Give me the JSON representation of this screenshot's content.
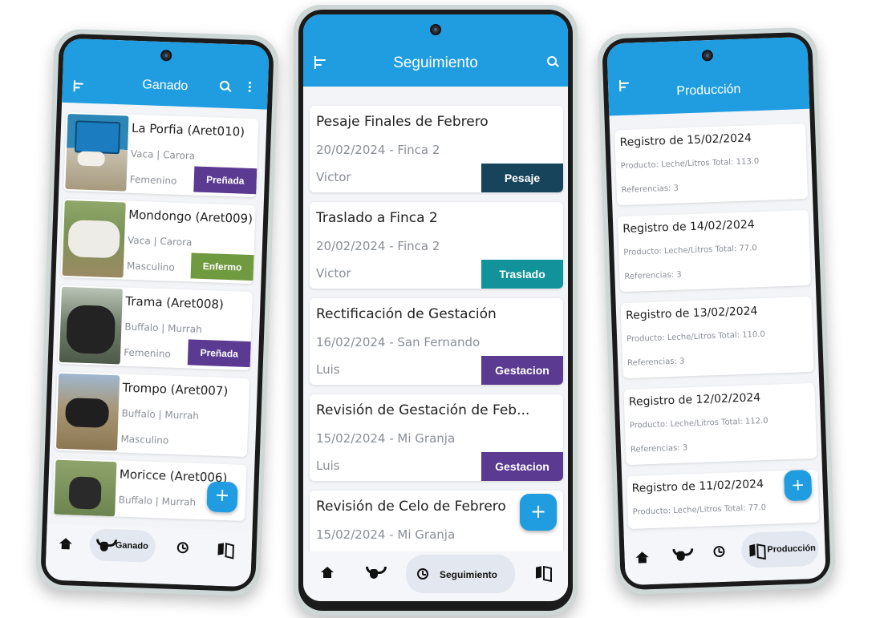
{
  "colors": {
    "primary": "#1f9de0",
    "pesaje": "#17445a",
    "traslado": "#12939b",
    "gestacion": "#5b3a91",
    "prenada": "#5b3a91",
    "enfermo": "#6f9a3f"
  },
  "ganado": {
    "title": "Ganado",
    "animals": [
      {
        "name": "La Porfia  (Aret010)",
        "breed": "Vaca | Carora",
        "sex": "Femenino",
        "status": "Preñada"
      },
      {
        "name": "Mondongo (Aret009)",
        "breed": "Vaca | Carora",
        "sex": "Masculino",
        "status": "Enfermo"
      },
      {
        "name": "Trama (Aret008)",
        "breed": "Buffalo | Murrah",
        "sex": "Femenino",
        "status": "Preñada"
      },
      {
        "name": "Trompo (Aret007)",
        "breed": "Buffalo | Murrah",
        "sex": "Masculino",
        "status": ""
      },
      {
        "name": "Moricce (Aret006)",
        "breed": "Buffalo | Murrah",
        "sex": "",
        "status": ""
      }
    ],
    "fab": "+",
    "nav": {
      "active_label": "Ganado"
    }
  },
  "seguimiento": {
    "title": "Seguimiento",
    "events": [
      {
        "title": "Pesaje Finales de Febrero",
        "date_place": "20/02/2024 - Finca 2",
        "person": "Victor",
        "type": "Pesaje"
      },
      {
        "title": "Traslado a Finca 2",
        "date_place": "20/02/2024 - Finca 2",
        "person": "Victor",
        "type": "Traslado"
      },
      {
        "title": "Rectificación de Gestación",
        "date_place": "16/02/2024 - San Fernando",
        "person": "Luis",
        "type": "Gestacion"
      },
      {
        "title": "Revisión de Gestación de Feb...",
        "date_place": "15/02/2024 - Mi Granja",
        "person": "Luis",
        "type": "Gestacion"
      },
      {
        "title": "Revisión de Celo de Febrero",
        "date_place": "15/02/2024 - Mi Granja",
        "person": "",
        "type": ""
      }
    ],
    "fab": "+",
    "nav": {
      "active_label": "Seguimiento"
    }
  },
  "produccion": {
    "title": "Producción",
    "records": [
      {
        "title": "Registro de 15/02/2024",
        "product": "Producto: Leche/Litros Total: 113.0",
        "refs": "Referencias: 3"
      },
      {
        "title": "Registro de 14/02/2024",
        "product": "Producto: Leche/Litros Total: 77.0",
        "refs": "Referencias: 3"
      },
      {
        "title": "Registro de 13/02/2024",
        "product": "Producto: Leche/Litros Total: 110.0",
        "refs": "Referencias: 3"
      },
      {
        "title": "Registro de 12/02/2024",
        "product": "Producto: Leche/Litros Total: 112.0",
        "refs": "Referencias: 3"
      },
      {
        "title": "Registro de 11/02/2024",
        "product": "Producto: Leche/Litros Total: 77.0",
        "refs": ""
      }
    ],
    "fab": "+",
    "nav": {
      "active_label": "Producción"
    }
  }
}
